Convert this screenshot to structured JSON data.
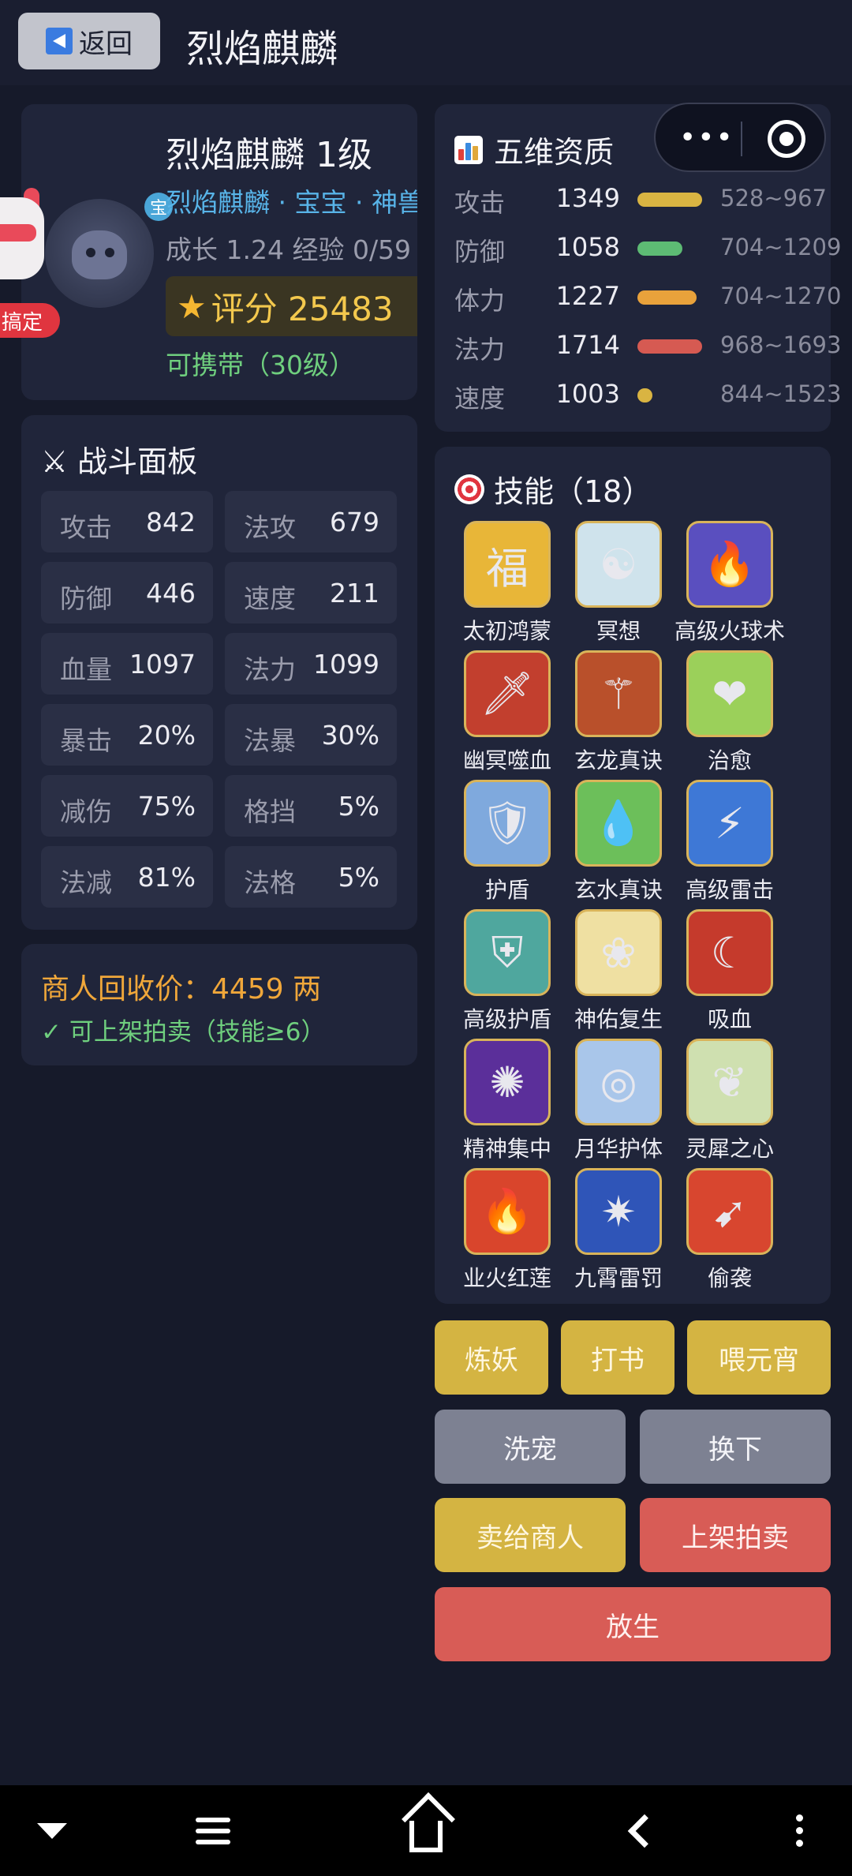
{
  "header": {
    "back_label": "返回",
    "title": "烈焰麒麟"
  },
  "capsule": {
    "more": "•••"
  },
  "pet": {
    "name_level": "烈焰麒麟  1级",
    "tags": "烈焰麒麟 · 宝宝 · 神兽",
    "badge": "宝",
    "growth": "成长 1.24   经验 0/59",
    "score_label": "评分 25483",
    "carry": "可携带（30级）"
  },
  "mascot": {
    "label": "搞定"
  },
  "attributes": {
    "title": "五维资质",
    "rows": [
      {
        "label": "攻击",
        "value": "1349",
        "range": "528~967",
        "fill": 1.0,
        "color": "#d9b442"
      },
      {
        "label": "防御",
        "value": "1058",
        "range": "704~1209",
        "fill": 0.7,
        "color": "#5dbb74"
      },
      {
        "label": "体力",
        "value": "1227",
        "range": "704~1270",
        "fill": 0.92,
        "color": "#e9a23b"
      },
      {
        "label": "法力",
        "value": "1714",
        "range": "968~1693",
        "fill": 1.0,
        "color": "#d65a52"
      },
      {
        "label": "速度",
        "value": "1003",
        "range": "844~1523",
        "fill": 0.23,
        "color": "#d9b442"
      }
    ]
  },
  "battle": {
    "title": "战斗面板",
    "stats": [
      {
        "label": "攻击",
        "value": "842"
      },
      {
        "label": "法攻",
        "value": "679"
      },
      {
        "label": "防御",
        "value": "446"
      },
      {
        "label": "速度",
        "value": "211"
      },
      {
        "label": "血量",
        "value": "1097"
      },
      {
        "label": "法力",
        "value": "1099"
      },
      {
        "label": "暴击",
        "value": "20%"
      },
      {
        "label": "法暴",
        "value": "30%"
      },
      {
        "label": "减伤",
        "value": "75%"
      },
      {
        "label": "格挡",
        "value": "5%"
      },
      {
        "label": "法减",
        "value": "81%"
      },
      {
        "label": "法格",
        "value": "5%"
      }
    ]
  },
  "recycle": {
    "price": "商人回收价：4459 两",
    "auction_ok": "✓ 可上架拍卖（技能≥6）"
  },
  "skills": {
    "title": "技能（18）",
    "items": [
      {
        "name": "太初鸿蒙",
        "glyph": "福",
        "bg": "#e8b638"
      },
      {
        "name": "冥想",
        "glyph": "☯",
        "bg": "#cfe3ec"
      },
      {
        "name": "高级火球术",
        "glyph": "🔥",
        "bg": "#5a4fbf"
      },
      {
        "name": "幽冥噬血",
        "glyph": "🗡",
        "bg": "#c23f2e"
      },
      {
        "name": "玄龙真诀",
        "glyph": "⚚",
        "bg": "#b9502b"
      },
      {
        "name": "治愈",
        "glyph": "❤",
        "bg": "#9bd05a"
      },
      {
        "name": "护盾",
        "glyph": "🛡",
        "bg": "#7fa9dd"
      },
      {
        "name": "玄水真诀",
        "glyph": "💧",
        "bg": "#6cbf5a"
      },
      {
        "name": "高级雷击",
        "glyph": "⚡",
        "bg": "#3e78d6"
      },
      {
        "name": "高级护盾",
        "glyph": "⛨",
        "bg": "#4fa79e"
      },
      {
        "name": "神佑复生",
        "glyph": "❀",
        "bg": "#efe0a2"
      },
      {
        "name": "吸血",
        "glyph": "☾",
        "bg": "#c53a2c"
      },
      {
        "name": "精神集中",
        "glyph": "✺",
        "bg": "#5b2f9a"
      },
      {
        "name": "月华护体",
        "glyph": "◎",
        "bg": "#a9c6ea"
      },
      {
        "name": "灵犀之心",
        "glyph": "❦",
        "bg": "#cfe0b0"
      },
      {
        "name": "业火红莲",
        "glyph": "🔥",
        "bg": "#d9452c"
      },
      {
        "name": "九霄雷罚",
        "glyph": "✷",
        "bg": "#2f55b8"
      },
      {
        "name": "偷袭",
        "glyph": "➹",
        "bg": "#d8462f"
      }
    ]
  },
  "actions": {
    "refine": "炼妖",
    "book": "打书",
    "feed": "喂元宵",
    "wash": "洗宠",
    "swap": "换下",
    "sell_merchant": "卖给商人",
    "auction": "上架拍卖",
    "release": "放生"
  }
}
